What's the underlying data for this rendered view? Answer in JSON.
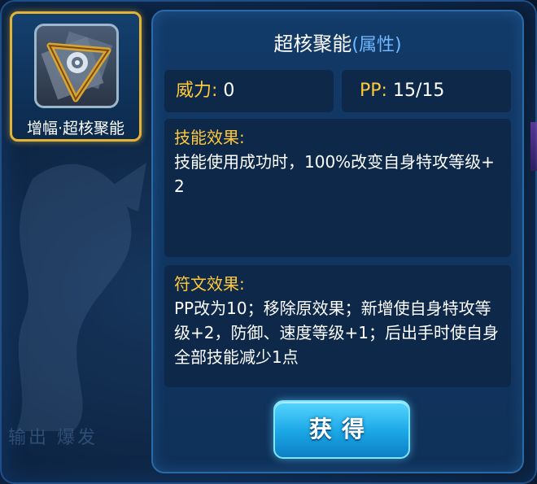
{
  "skill_card": {
    "name": "增幅·超核聚能",
    "icon": "triangle-emblem-icon"
  },
  "panel": {
    "title": "超核聚能",
    "attribute": "(属性)",
    "power_label": "威力:",
    "power_value": "0",
    "pp_label": "PP:",
    "pp_value": "15/15",
    "effect_title": "技能效果:",
    "effect_text": "技能使用成功时，100%改变自身特攻等级+2",
    "rune_title": "符文效果:",
    "rune_text": "PP改为10；移除原效果；新增使自身特攻等级+2，防御、速度等级+1；后出手时使自身全部技能减少1点"
  },
  "button": {
    "get_label": "获得"
  },
  "background": {
    "faded_text": "输出 爆发"
  },
  "colors": {
    "gold": "#ffc93a",
    "attribute_blue": "#6fb7ff",
    "panel_bg": "#123a68"
  }
}
